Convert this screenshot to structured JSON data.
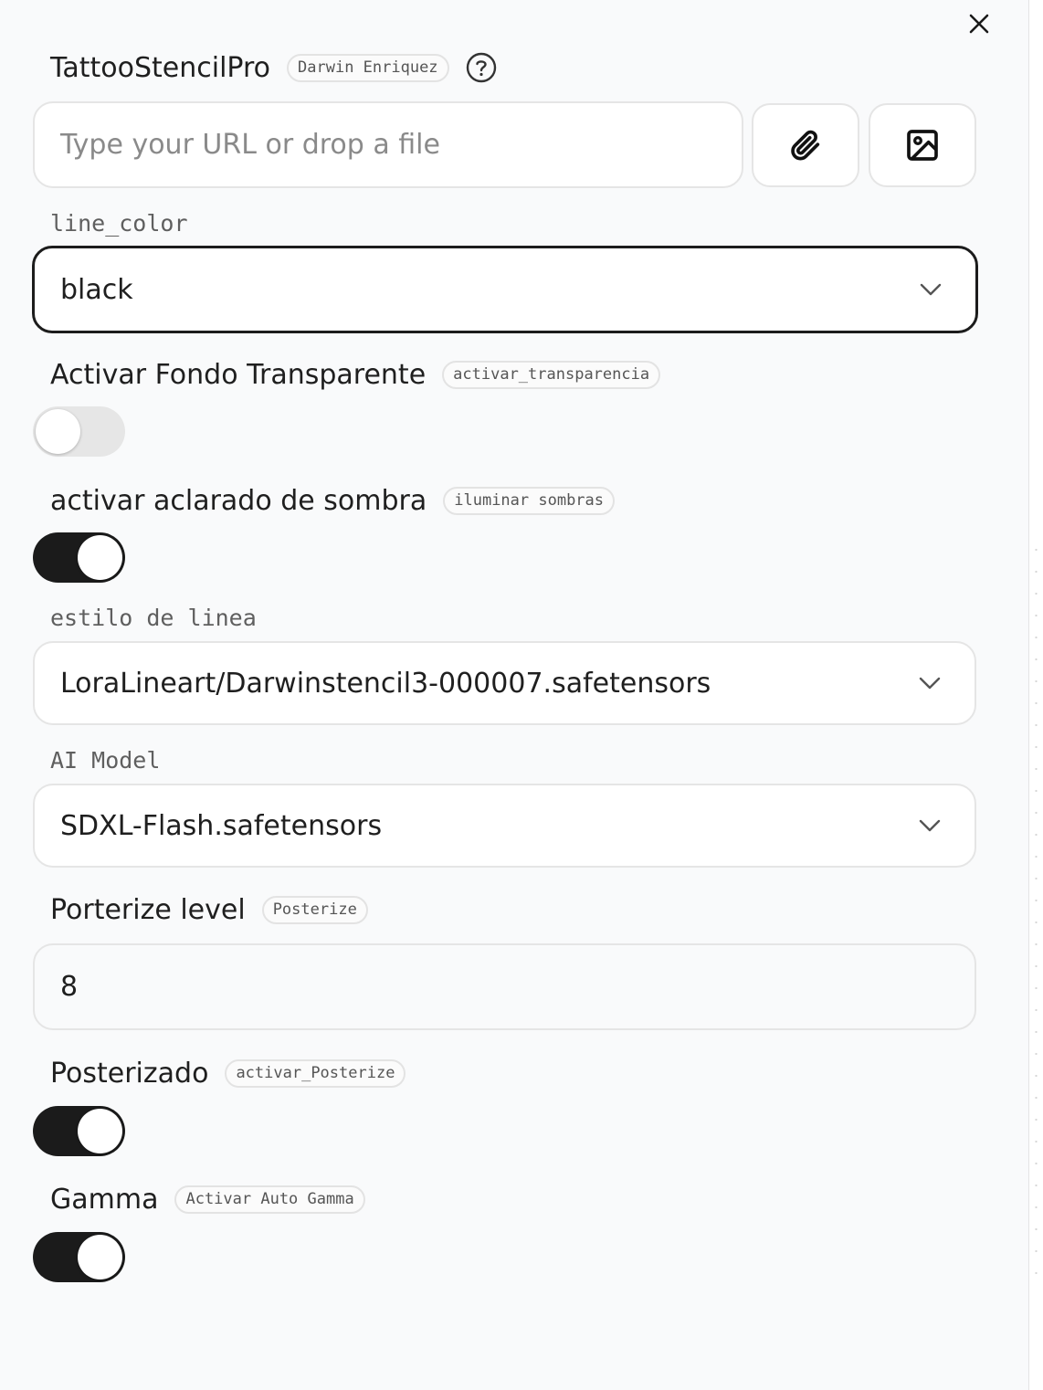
{
  "app": {
    "title": "TattooStencilPro",
    "author_badge": "Darwin Enriquez",
    "close_icon": "close-icon",
    "help_icon": "help-circle-icon"
  },
  "url_input": {
    "value": "",
    "placeholder": "Type your URL or drop a file",
    "attach_icon": "paperclip-icon",
    "image_icon": "image-icon"
  },
  "line_color": {
    "label": "line_color",
    "value": "black"
  },
  "transparency": {
    "label": "Activar Fondo Transparente",
    "badge": "activar_transparencia",
    "enabled": false
  },
  "shadows": {
    "label": "activar aclarado de sombra",
    "badge": "iluminar sombras",
    "enabled": true
  },
  "line_style": {
    "label": "estilo de linea",
    "value": "LoraLineart/Darwinstencil3-000007.safetensors"
  },
  "ai_model": {
    "label": "AI Model",
    "value": "SDXL-Flash.safetensors"
  },
  "posterize_level": {
    "label": "Porterize level",
    "badge": "Posterize",
    "value": "8"
  },
  "posterizado": {
    "label": "Posterizado",
    "badge": "activar_Posterize",
    "enabled": true
  },
  "gamma": {
    "label": "Gamma",
    "badge": "Activar Auto Gamma",
    "enabled": true
  },
  "colors": {
    "accent": "#1b1b1b",
    "toggle_off": "#e6e6e6",
    "background": "#f9fafb"
  }
}
